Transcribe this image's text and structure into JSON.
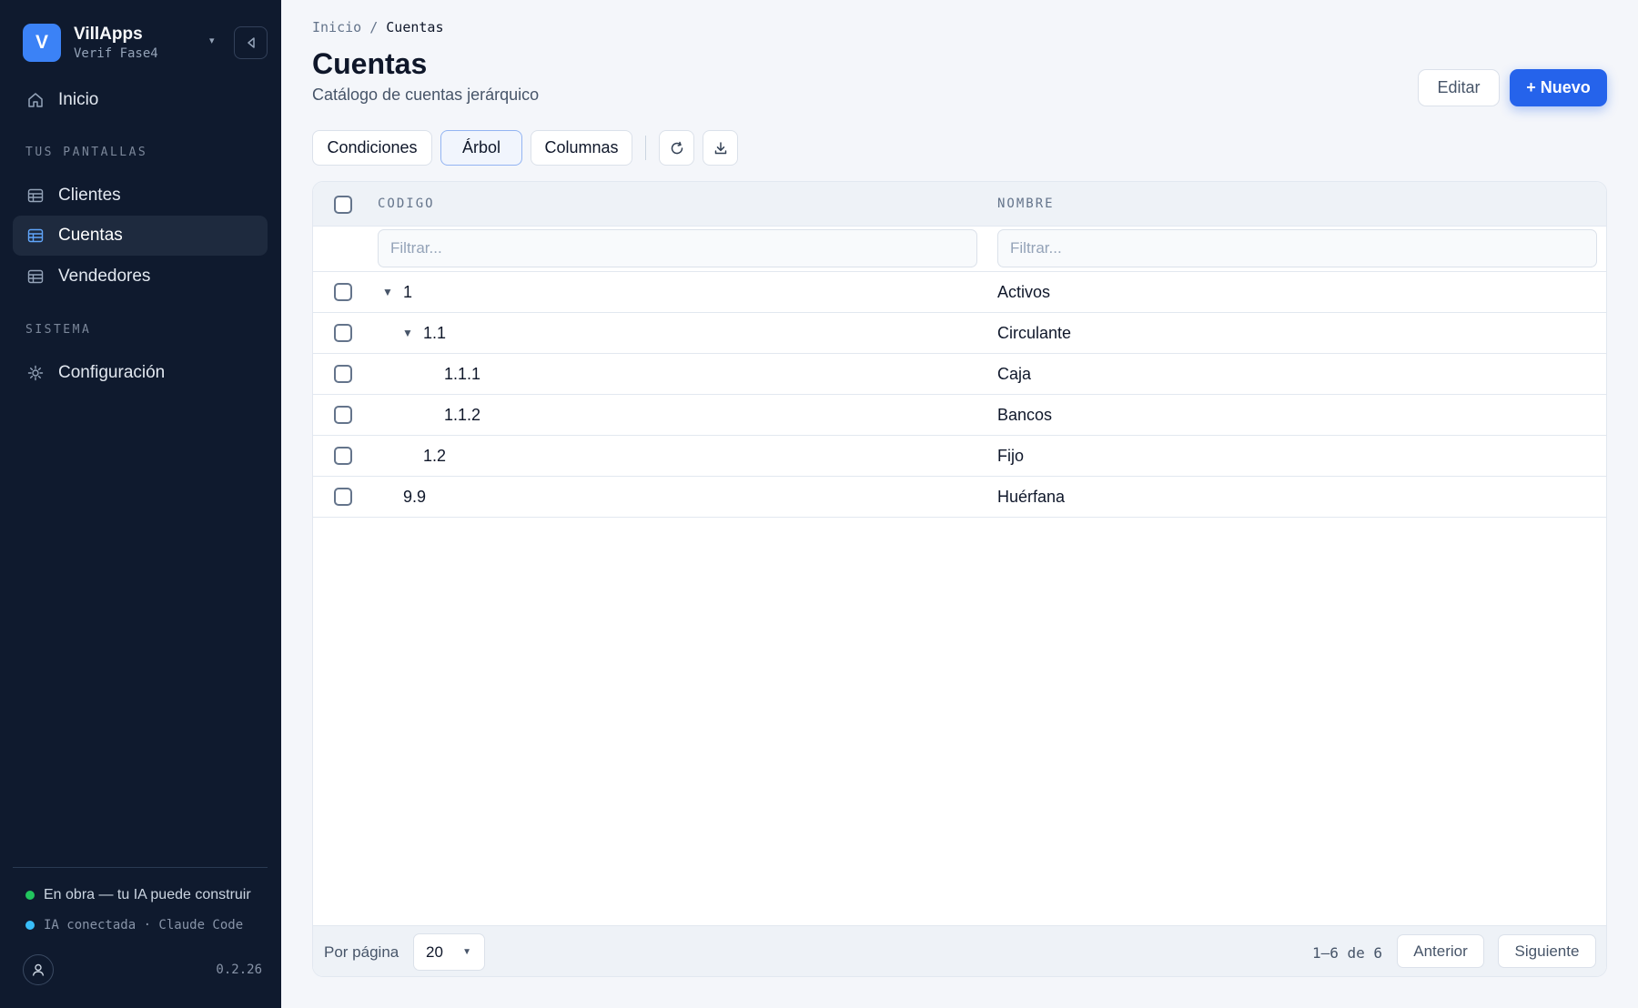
{
  "app": {
    "logo_letter": "V",
    "name": "VillApps",
    "workspace": "Verif Fase4"
  },
  "nav": {
    "home": "Inicio",
    "section_screens": "TUS PANTALLAS",
    "screens": [
      "Clientes",
      "Cuentas",
      "Vendedores"
    ],
    "section_system": "SISTEMA",
    "settings": "Configuración"
  },
  "sidebar_footer": {
    "build_status": "En obra — tu IA puede construir",
    "ai_status": "IA conectada · Claude Code",
    "version": "0.2.26"
  },
  "breadcrumb": {
    "home": "Inicio",
    "separator": "/",
    "current": "Cuentas"
  },
  "page": {
    "title": "Cuentas",
    "subtitle": "Catálogo de cuentas jerárquico"
  },
  "actions": {
    "edit": "Editar",
    "new": "+ Nuevo"
  },
  "toolbar": {
    "conditions": "Condiciones",
    "tree": "Árbol",
    "columns": "Columnas"
  },
  "table": {
    "columns": [
      "CODIGO",
      "NOMBRE"
    ],
    "filter_placeholder": "Filtrar...",
    "rows": [
      {
        "code": "1",
        "name": "Activos",
        "level": 0,
        "expanded": true
      },
      {
        "code": "1.1",
        "name": "Circulante",
        "level": 1,
        "expanded": true
      },
      {
        "code": "1.1.1",
        "name": "Caja",
        "level": 2
      },
      {
        "code": "1.1.2",
        "name": "Bancos",
        "level": 2
      },
      {
        "code": "1.2",
        "name": "Fijo",
        "level": 1
      },
      {
        "code": "9.9",
        "name": "Huérfana",
        "level": 0
      }
    ]
  },
  "pagination": {
    "per_page_label": "Por página",
    "per_page_value": "20",
    "range": "1–6 de 6",
    "prev": "Anterior",
    "next": "Siguiente"
  },
  "colors": {
    "sidebar_bg": "#0f1a2e",
    "accent": "#2563eb",
    "status_green": "#22c55e",
    "status_blue": "#38bdf8"
  }
}
